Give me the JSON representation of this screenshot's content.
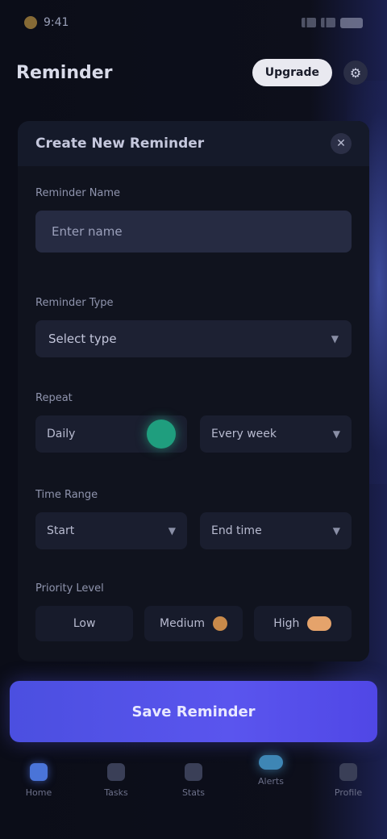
{
  "status_bar": {
    "time": "9:41",
    "icons": [
      "signal-icon",
      "wifi-icon",
      "battery-icon"
    ]
  },
  "header": {
    "title": "Reminder",
    "pill_label": "Upgrade",
    "icon": "gear-icon"
  },
  "card": {
    "title": "Create New Reminder",
    "close_icon": "close-icon",
    "sections": {
      "name": {
        "label": "Reminder Name",
        "placeholder": "Enter name"
      },
      "type": {
        "label": "Reminder Type",
        "value": "Select type"
      },
      "repeat": {
        "label": "Repeat",
        "left": "Daily",
        "right": "Every week"
      },
      "time": {
        "label": "Time Range",
        "left": "Start",
        "right": "End time"
      },
      "priority": {
        "label": "Priority Level",
        "chips": [
          "Low",
          "Medium",
          "High"
        ]
      }
    }
  },
  "primary_button": {
    "label": "Save Reminder"
  },
  "bottom_nav": {
    "items": [
      {
        "label": "Home",
        "icon": "home-icon"
      },
      {
        "label": "Tasks",
        "icon": "list-icon"
      },
      {
        "label": "Stats",
        "icon": "chart-icon"
      },
      {
        "label": "Alerts",
        "icon": "bell-icon"
      },
      {
        "label": "Profile",
        "icon": "user-icon"
      }
    ]
  },
  "colors": {
    "accent": "#5a55ee",
    "toggle": "#1f9e7e",
    "background": "#0b0d16"
  }
}
